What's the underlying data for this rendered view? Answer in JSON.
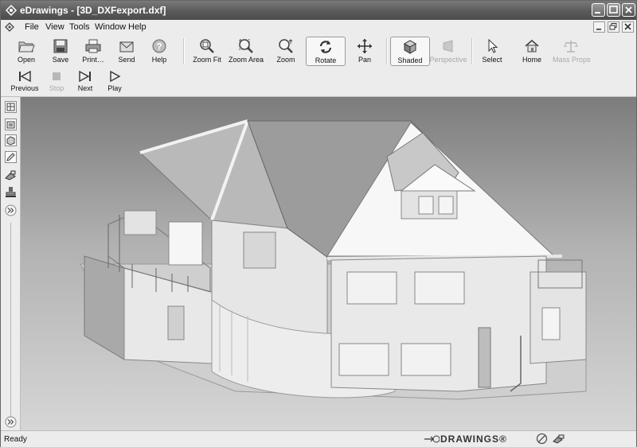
{
  "window": {
    "title": "eDrawings - [3D_DXFexport.dxf]"
  },
  "menu": {
    "items": [
      "File",
      "View",
      "Tools",
      "Window",
      "Help"
    ]
  },
  "toolbar": {
    "file_buttons": [
      {
        "label": "Open",
        "icon": "open-folder-icon"
      },
      {
        "label": "Save",
        "icon": "save-disk-icon"
      },
      {
        "label": "Print…",
        "icon": "printer-icon"
      },
      {
        "label": "Send",
        "icon": "envelope-icon"
      },
      {
        "label": "Help",
        "icon": "help-icon"
      }
    ],
    "view_buttons": [
      {
        "label": "Zoom Fit",
        "icon": "zoom-fit-icon"
      },
      {
        "label": "Zoom Area",
        "icon": "zoom-area-icon"
      },
      {
        "label": "Zoom",
        "icon": "zoom-icon"
      },
      {
        "label": "Rotate",
        "icon": "rotate-icon",
        "active": true
      },
      {
        "label": "Pan",
        "icon": "pan-icon"
      }
    ],
    "display_buttons": [
      {
        "label": "Shaded",
        "icon": "shaded-cube-icon",
        "active": true
      },
      {
        "label": "Perspective",
        "icon": "perspective-icon",
        "disabled": true
      }
    ],
    "tool_buttons": [
      {
        "label": "Select",
        "icon": "select-arrow-icon"
      },
      {
        "label": "Home",
        "icon": "home-icon"
      },
      {
        "label": "Mass Props",
        "icon": "scale-icon",
        "disabled": true
      }
    ]
  },
  "playback": {
    "buttons": [
      {
        "label": "Previous",
        "icon": "previous-icon"
      },
      {
        "label": "Stop",
        "icon": "stop-icon",
        "disabled": true
      },
      {
        "label": "Next",
        "icon": "next-icon"
      },
      {
        "label": "Play",
        "icon": "play-icon"
      }
    ]
  },
  "statusbar": {
    "status": "Ready",
    "brand": "DRAWINGS®"
  },
  "colors": {
    "titlebar": "#5a5a5a",
    "chrome": "#ececec",
    "viewport_top": "#7c7c7c",
    "viewport_bottom": "#d6d6d6"
  }
}
